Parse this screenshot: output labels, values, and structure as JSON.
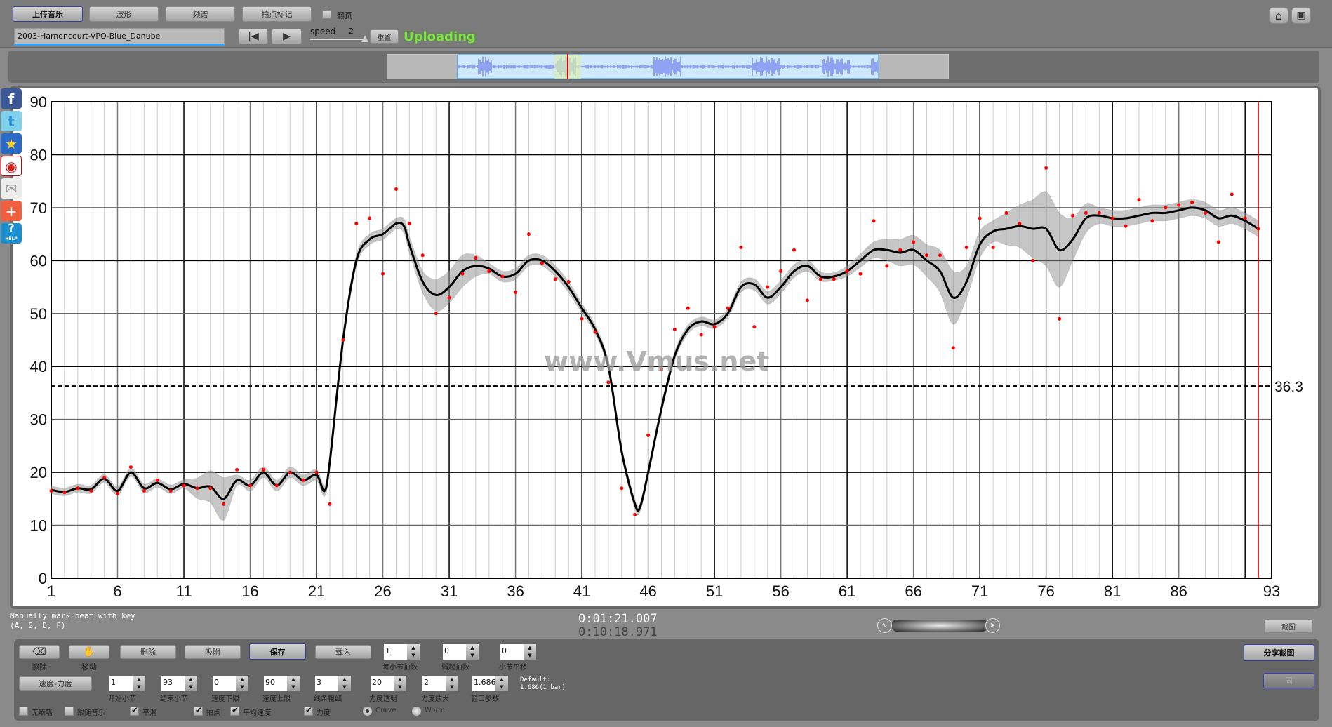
{
  "toolbar": {
    "tabs": [
      {
        "label": "上传音乐",
        "active": true
      },
      {
        "label": "波形"
      },
      {
        "label": "频谱"
      },
      {
        "label": "拍点标记"
      }
    ],
    "page_turn_label": "翻页",
    "page_turn_checked": false,
    "filename": "2003-Harnoncourt-VPO-Blue_Danube",
    "speed_label": "speed",
    "speed_value": "2",
    "reset_label": "重置",
    "status": "Uploading",
    "status_color": "#7ee04a"
  },
  "topright_icons": [
    "home-icon",
    "fullscreen-icon"
  ],
  "social": [
    "facebook-icon",
    "twitter-icon",
    "qzone-icon",
    "weibo-icon",
    "email-icon",
    "add-icon",
    "help-icon"
  ],
  "social_help_text": "HELP",
  "watermark": "www.Vmus.net",
  "hint": {
    "line1": "Manually mark beat with key",
    "line2": "(A, S, D, F)"
  },
  "time": {
    "current": "0:01:21.007",
    "total": "0:10:18.971"
  },
  "screenshot_label": "截图",
  "share_label": "分享截图",
  "sync_label": "同",
  "controls": {
    "tools": [
      {
        "label": "擦除",
        "icon": "eraser-icon"
      },
      {
        "label": "移动",
        "icon": "move-icon"
      }
    ],
    "buttons": [
      "删除",
      "吸附",
      "保存",
      "载入"
    ],
    "row1_spinners": [
      {
        "label": "每小节拍数",
        "value": "1"
      },
      {
        "label": "弱起拍数",
        "value": "0"
      },
      {
        "label": "小节平移",
        "value": "0"
      }
    ],
    "mode_label": "速度-力度",
    "row2_spinners": [
      {
        "label": "开始小节",
        "value": "1"
      },
      {
        "label": "结束小节",
        "value": "93"
      },
      {
        "label": "速度下限",
        "value": "0"
      },
      {
        "label": "速度上限",
        "value": "90"
      },
      {
        "label": "线条粗细",
        "value": "3"
      },
      {
        "label": "力度透明",
        "value": "20"
      },
      {
        "label": "力度放大",
        "value": "2"
      },
      {
        "label": "窗口参数",
        "value": "1.686"
      }
    ],
    "default_line1": "Default:",
    "default_line2": "1.686(1 bar)",
    "checks": [
      {
        "label": "无嘀嗒",
        "checked": false
      },
      {
        "label": "跟随音乐",
        "checked": false
      },
      {
        "label": "平滑",
        "checked": true
      },
      {
        "label": "拍点",
        "checked": true
      },
      {
        "label": "平均速度",
        "checked": true
      },
      {
        "label": "力度",
        "checked": true
      }
    ],
    "radios": [
      {
        "label": "Curve",
        "checked": true
      },
      {
        "label": "Worm",
        "checked": false
      }
    ]
  },
  "chart_data": {
    "type": "line",
    "xlim": [
      1,
      93
    ],
    "ylim": [
      0,
      90
    ],
    "x_ticks": [
      "1",
      "6",
      "11",
      "16",
      "21",
      "26",
      "31",
      "36",
      "41",
      "46",
      "51",
      "56",
      "61",
      "66",
      "71",
      "76",
      "81",
      "86",
      "93"
    ],
    "y_ticks": [
      "0",
      "10",
      "20",
      "30",
      "40",
      "50",
      "60",
      "70",
      "80",
      "90"
    ],
    "grid": true,
    "average_tempo": 36.3,
    "average_label": "36.3",
    "cursor_bar": 92,
    "curve": [
      [
        1,
        16.7
      ],
      [
        2,
        16.3
      ],
      [
        3,
        17
      ],
      [
        4,
        16.8
      ],
      [
        5,
        18.8
      ],
      [
        6,
        16.5
      ],
      [
        7,
        20
      ],
      [
        8,
        17
      ],
      [
        9,
        18
      ],
      [
        10,
        16.8
      ],
      [
        11,
        17.8
      ],
      [
        12,
        17
      ],
      [
        13,
        17.3
      ],
      [
        14,
        15
      ],
      [
        15,
        18.5
      ],
      [
        16,
        17.5
      ],
      [
        17,
        20
      ],
      [
        18,
        17.5
      ],
      [
        19,
        20
      ],
      [
        20,
        18.5
      ],
      [
        21,
        19.5
      ],
      [
        21.6,
        16.5
      ],
      [
        22,
        22
      ],
      [
        23,
        45
      ],
      [
        24,
        60
      ],
      [
        25,
        64
      ],
      [
        26,
        65
      ],
      [
        27,
        67
      ],
      [
        27.6,
        66.5
      ],
      [
        28,
        63
      ],
      [
        29,
        56
      ],
      [
        30,
        53.5
      ],
      [
        31,
        55
      ],
      [
        32,
        58
      ],
      [
        33,
        59
      ],
      [
        34,
        58.5
      ],
      [
        35,
        57
      ],
      [
        36,
        57.5
      ],
      [
        37,
        60
      ],
      [
        38,
        60
      ],
      [
        39,
        58
      ],
      [
        40,
        55
      ],
      [
        41,
        51
      ],
      [
        42,
        47
      ],
      [
        43,
        40
      ],
      [
        44,
        24
      ],
      [
        45,
        14
      ],
      [
        45.4,
        13.5
      ],
      [
        46,
        20
      ],
      [
        47,
        32
      ],
      [
        48,
        42
      ],
      [
        49,
        47
      ],
      [
        50,
        48.5
      ],
      [
        51,
        48
      ],
      [
        52,
        50
      ],
      [
        53,
        55
      ],
      [
        54,
        55.5
      ],
      [
        55,
        53
      ],
      [
        56,
        55
      ],
      [
        57,
        58
      ],
      [
        58,
        59
      ],
      [
        59,
        57
      ],
      [
        60,
        57
      ],
      [
        61,
        58
      ],
      [
        62,
        60
      ],
      [
        63,
        62
      ],
      [
        64,
        62
      ],
      [
        65,
        61.5
      ],
      [
        66,
        62
      ],
      [
        67,
        60
      ],
      [
        68,
        58
      ],
      [
        69,
        53
      ],
      [
        70,
        56
      ],
      [
        71,
        63
      ],
      [
        72,
        65.5
      ],
      [
        73,
        66
      ],
      [
        74,
        66.5
      ],
      [
        75,
        66
      ],
      [
        76,
        66
      ],
      [
        77,
        62
      ],
      [
        78,
        64
      ],
      [
        79,
        68
      ],
      [
        80,
        68.5
      ],
      [
        81,
        68
      ],
      [
        82,
        68
      ],
      [
        83,
        68.5
      ],
      [
        84,
        69
      ],
      [
        85,
        69
      ],
      [
        86,
        69.5
      ],
      [
        87,
        70
      ],
      [
        88,
        69.5
      ],
      [
        89,
        68
      ],
      [
        90,
        68.5
      ],
      [
        91,
        67.5
      ],
      [
        92,
        66
      ]
    ],
    "band_halfwidth": [
      [
        1,
        0.7
      ],
      [
        11,
        0.8
      ],
      [
        13,
        3
      ],
      [
        14,
        4
      ],
      [
        15,
        1
      ],
      [
        27,
        1
      ],
      [
        29,
        2
      ],
      [
        30,
        3
      ],
      [
        32,
        3
      ],
      [
        34,
        1
      ],
      [
        40,
        1
      ],
      [
        42,
        0.8
      ],
      [
        52,
        0.8
      ],
      [
        55,
        1.2
      ],
      [
        57,
        1.2
      ],
      [
        60,
        0.7
      ],
      [
        63,
        1.5
      ],
      [
        65,
        2.5
      ],
      [
        67,
        3
      ],
      [
        69,
        5
      ],
      [
        70,
        3
      ],
      [
        72,
        2
      ],
      [
        74,
        4
      ],
      [
        76,
        7
      ],
      [
        77,
        7
      ],
      [
        78,
        4
      ],
      [
        80,
        1.5
      ],
      [
        92,
        1.5
      ]
    ],
    "beats": [
      [
        1,
        16.5
      ],
      [
        2,
        16.2
      ],
      [
        3,
        17
      ],
      [
        4,
        16.5
      ],
      [
        5,
        19
      ],
      [
        6,
        16
      ],
      [
        7,
        21
      ],
      [
        8,
        16.5
      ],
      [
        9,
        18.5
      ],
      [
        10,
        16.5
      ],
      [
        11,
        17.5
      ],
      [
        12,
        17
      ],
      [
        13,
        17
      ],
      [
        14,
        14
      ],
      [
        15,
        20.5
      ],
      [
        16,
        17.5
      ],
      [
        17,
        20.5
      ],
      [
        18,
        17.5
      ],
      [
        19,
        20
      ],
      [
        20,
        18.5
      ],
      [
        21,
        20
      ],
      [
        22,
        14
      ],
      [
        23,
        45
      ],
      [
        24,
        67
      ],
      [
        25,
        68
      ],
      [
        26,
        57.5
      ],
      [
        27,
        73.5
      ],
      [
        28,
        67
      ],
      [
        29,
        61
      ],
      [
        30,
        50
      ],
      [
        31,
        53
      ],
      [
        32,
        57.5
      ],
      [
        33,
        60.5
      ],
      [
        34,
        58
      ],
      [
        35,
        57
      ],
      [
        36,
        54
      ],
      [
        37,
        65
      ],
      [
        38,
        59.5
      ],
      [
        39,
        56.5
      ],
      [
        40,
        56
      ],
      [
        41,
        49
      ],
      [
        42,
        46.5
      ],
      [
        43,
        37
      ],
      [
        44,
        17
      ],
      [
        45,
        12
      ],
      [
        46,
        27
      ],
      [
        47,
        39.5
      ],
      [
        48,
        47
      ],
      [
        49,
        51
      ],
      [
        50,
        46
      ],
      [
        51,
        47.5
      ],
      [
        52,
        51
      ],
      [
        53,
        62.5
      ],
      [
        54,
        47.5
      ],
      [
        55,
        55
      ],
      [
        56,
        58
      ],
      [
        57,
        62
      ],
      [
        58,
        52.5
      ],
      [
        59,
        56.5
      ],
      [
        60,
        56.5
      ],
      [
        61,
        58
      ],
      [
        62,
        57.5
      ],
      [
        63,
        67.5
      ],
      [
        64,
        59
      ],
      [
        65,
        62
      ],
      [
        66,
        63.5
      ],
      [
        67,
        61
      ],
      [
        68,
        61
      ],
      [
        69,
        43.5
      ],
      [
        70,
        62.5
      ],
      [
        71,
        68
      ],
      [
        72,
        62.5
      ],
      [
        73,
        69
      ],
      [
        74,
        67
      ],
      [
        75,
        60
      ],
      [
        76,
        77.5
      ],
      [
        77,
        49
      ],
      [
        78,
        68.5
      ],
      [
        79,
        69
      ],
      [
        80,
        69
      ],
      [
        81,
        68
      ],
      [
        82,
        66.5
      ],
      [
        83,
        71.5
      ],
      [
        84,
        67.5
      ],
      [
        85,
        70
      ],
      [
        86,
        70.5
      ],
      [
        87,
        71
      ],
      [
        88,
        69
      ],
      [
        89,
        63.5
      ],
      [
        90,
        72.5
      ],
      [
        91,
        68
      ],
      [
        92,
        66
      ]
    ]
  }
}
